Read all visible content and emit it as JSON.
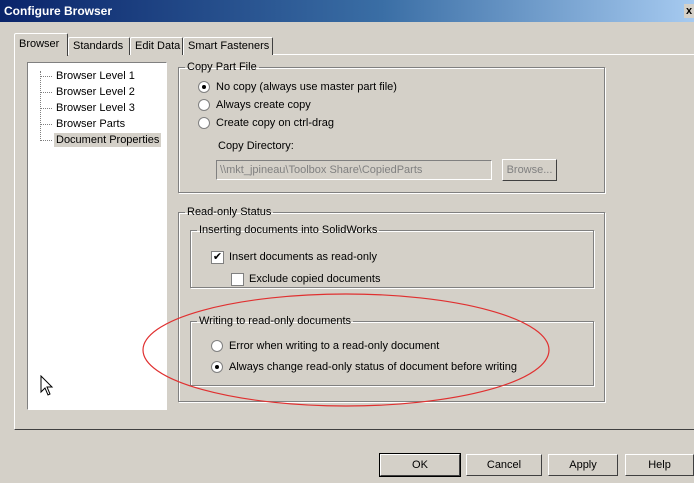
{
  "window": {
    "title": "Configure Browser",
    "close_glyph": "x"
  },
  "tabs": [
    {
      "label": "Browser",
      "active": true
    },
    {
      "label": "Standards",
      "active": false
    },
    {
      "label": "Edit Data",
      "active": false
    },
    {
      "label": "Smart Fasteners",
      "active": false
    }
  ],
  "tree": {
    "items": [
      {
        "label": "Browser Level 1"
      },
      {
        "label": "Browser Level 2"
      },
      {
        "label": "Browser Level 3"
      },
      {
        "label": "Browser Parts"
      },
      {
        "label": "Document Properties",
        "selected": true
      }
    ]
  },
  "copy_part_file": {
    "legend": "Copy Part File",
    "options": [
      {
        "label": "No copy (always use master part file)",
        "selected": true
      },
      {
        "label": "Always create copy",
        "selected": false
      },
      {
        "label": "Create copy on ctrl-drag",
        "selected": false
      }
    ],
    "directory_label": "Copy Directory:",
    "directory_value": "\\\\mkt_jpineau\\Toolbox Share\\CopiedParts",
    "browse_label": "Browse..."
  },
  "read_only_status": {
    "legend": "Read-only Status",
    "inserting": {
      "legend": "Inserting documents into SolidWorks",
      "insert_readonly": {
        "label": "Insert documents as read-only",
        "checked": true
      },
      "exclude_copied": {
        "label": "Exclude copied documents",
        "checked": false
      }
    },
    "writing": {
      "legend": "Writing to read-only documents",
      "options": [
        {
          "label": "Error when writing to a read-only document",
          "selected": false
        },
        {
          "label": "Always change read-only status of document before writing",
          "selected": true
        }
      ]
    }
  },
  "buttons": {
    "ok": "OK",
    "cancel": "Cancel",
    "apply": "Apply",
    "help": "Help"
  },
  "colors": {
    "annotation": "#e03030",
    "titlebar": "#0a246a",
    "face": "#d4d0c8"
  },
  "check_glyph": "✔"
}
